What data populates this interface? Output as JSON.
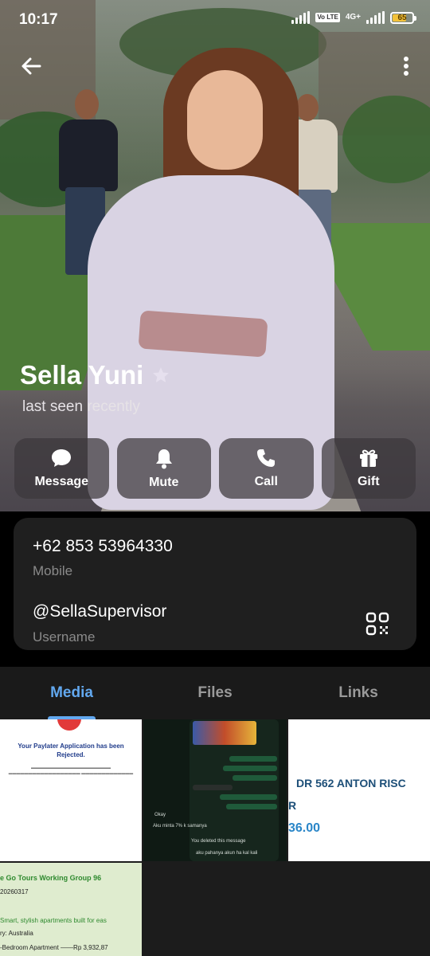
{
  "status_bar": {
    "time": "10:17",
    "volte": "Vo LTE",
    "network": "4G+",
    "battery": "65",
    "battery_level": 0.65
  },
  "profile": {
    "name": "Sella Yuni",
    "status": "last seen recently"
  },
  "actions": [
    {
      "label": "Message",
      "icon": "message-icon"
    },
    {
      "label": "Mute",
      "icon": "bell-icon"
    },
    {
      "label": "Call",
      "icon": "phone-icon"
    },
    {
      "label": "Gift",
      "icon": "gift-icon"
    }
  ],
  "info": {
    "phone": "+62 853 53964330",
    "phone_label": "Mobile",
    "username": "@SellaSupervisor",
    "username_label": "Username"
  },
  "tabs": [
    {
      "label": "Media",
      "active": true
    },
    {
      "label": "Files",
      "active": false
    },
    {
      "label": "Links",
      "active": false
    }
  ],
  "media": {
    "thumb1": {
      "title": "Your Paylater Application has been Rejected."
    },
    "thumb2": {
      "msg1": "Okay",
      "msg2": "Aku minta 7% k samanya",
      "msg3": "You deleted this message",
      "msg4": "aku pahanya akun ha kal kali"
    },
    "thumb3": {
      "title": "DR 562 ANTON RISC",
      "line2": "R",
      "amount": "36.00"
    },
    "thumb4": {
      "header": "e Go Tours Working Group 96",
      "line1": "20260317",
      "line2": "Smart, stylish apartments built for eas",
      "line3": "ry: Australia",
      "line4": "-Bedroom Apartment ——Rp 3,932,87"
    }
  },
  "colors": {
    "accent": "#62a8ef",
    "card_bg": "#1f1f1f",
    "battery": "#f3c23a"
  }
}
